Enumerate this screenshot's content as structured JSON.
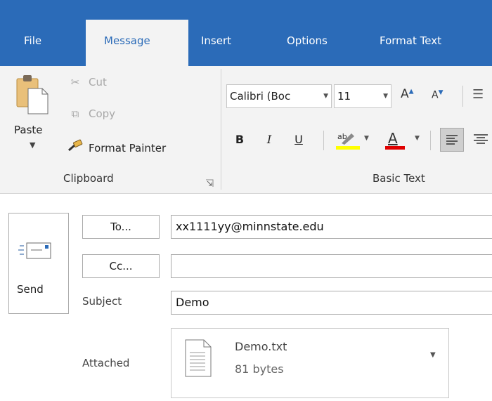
{
  "tabs": {
    "file": "File",
    "message": "Message",
    "insert": "Insert",
    "options": "Options",
    "format_text": "Format Text"
  },
  "clipboard": {
    "paste": "Paste",
    "cut": "Cut",
    "copy": "Copy",
    "format_painter": "Format Painter",
    "group_label": "Clipboard"
  },
  "basic_text": {
    "font_name": "Calibri (Boc",
    "font_size": "11",
    "bold": "B",
    "italic": "I",
    "underline": "U",
    "group_label": "Basic Text"
  },
  "compose": {
    "send": "Send",
    "to_button": "To...",
    "cc_button": "Cc...",
    "to_value": "xx1111yy@minnstate.edu",
    "cc_value": "",
    "subject_label": "Subject",
    "subject_value": "Demo",
    "attached_label": "Attached",
    "attachment_name": "Demo.txt",
    "attachment_size": "81 bytes"
  },
  "colors": {
    "accent": "#2b6bb8",
    "ribbon_bg": "#f3f3f3",
    "highlight": "#ffff00",
    "font_color": "#e00000"
  }
}
